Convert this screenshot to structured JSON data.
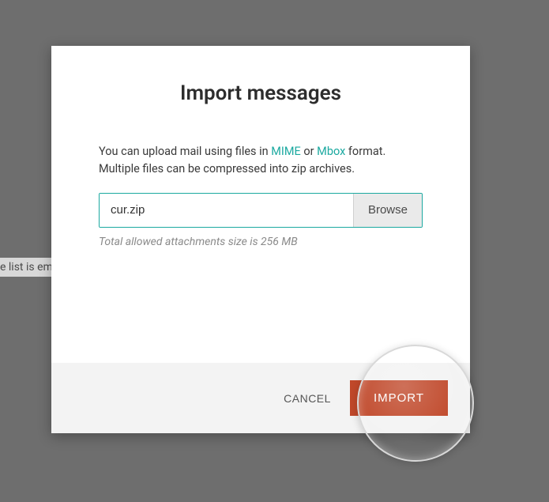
{
  "background": {
    "list_empty_text": "e list is em"
  },
  "modal": {
    "title": "Import messages",
    "description_prefix": "You can upload mail using files in ",
    "link_mime": "MIME",
    "description_or": " or ",
    "link_mbox": "Mbox",
    "description_suffix": " format. Multiple files can be compressed into zip archives.",
    "file_value": "cur.zip",
    "browse_label": "Browse",
    "hint": "Total allowed attachments size is 256 MB",
    "cancel_label": "CANCEL",
    "import_label": "IMPORT"
  }
}
